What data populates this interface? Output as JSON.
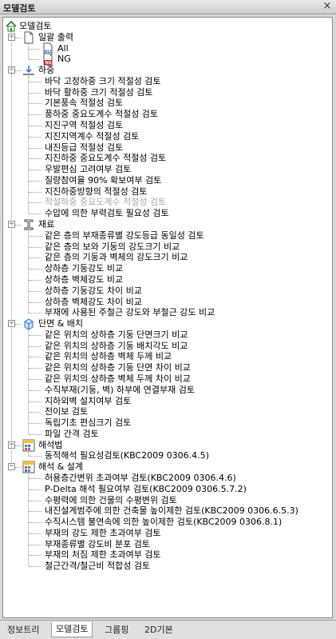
{
  "window": {
    "title": "모델검토"
  },
  "root": {
    "label": "모델검토"
  },
  "tree": [
    {
      "label": "일괄 출력",
      "icon": "document-icon",
      "children": [
        {
          "label": "All",
          "icon": "all-doc-icon"
        },
        {
          "label": "NG",
          "icon": "ng-doc-icon"
        }
      ]
    },
    {
      "label": "하중",
      "icon": "load-icon",
      "children": [
        {
          "label": "바닥 고정하중 크기 적절성 검토"
        },
        {
          "label": "바닥 활하중 크기 적절성 검토"
        },
        {
          "label": "기본풍속 적절성 검토"
        },
        {
          "label": "풍하중 중요도계수 적절성 검토"
        },
        {
          "label": "지진구역 적절성 검토"
        },
        {
          "label": "지진지역계수 적절성 검토"
        },
        {
          "label": "내진등급 적절성 검토"
        },
        {
          "label": "지진하중 중요도계수 적절성 검토"
        },
        {
          "label": "우발편심 고려여부 검토"
        },
        {
          "label": "질량참여율 90% 확보여부 검토"
        },
        {
          "label": "지진하중방향의 적절성 검토"
        },
        {
          "label": "적설하중 중요도계수 적절성 검토",
          "disabled": true
        },
        {
          "label": "수압에 의한 부력검토 필요성 검토"
        }
      ]
    },
    {
      "label": "재료",
      "icon": "material-icon",
      "children": [
        {
          "label": "같은 층의 부재종류별 강도등급 동일성 검토"
        },
        {
          "label": "같은 층의 보와 기둥의 강도크기 비교"
        },
        {
          "label": "같은 층의 기둥과 벽체의 강도크기 비교"
        },
        {
          "label": "상하층 기둥강도 비교"
        },
        {
          "label": "상하층 벽체강도 비교"
        },
        {
          "label": "상하층 기둥강도 차이 비교"
        },
        {
          "label": "상하층 벽체강도 차이 비교"
        },
        {
          "label": "부재에 사용된 주철근 강도와 부철근 강도 비교"
        }
      ]
    },
    {
      "label": "단면 & 배치",
      "icon": "section-icon",
      "children": [
        {
          "label": "같은 위치의 상하층 기둥 단면크기 비교"
        },
        {
          "label": "같은 위치의 상하층 기둥 배치각도 비교"
        },
        {
          "label": "같은 위치의 상하층 벽체 두께 비교"
        },
        {
          "label": "같은 위치의 상하층 기둥 단면 차이 비교"
        },
        {
          "label": "같은 위치의 상하층 벽체 두께 차이 비교"
        },
        {
          "label": "수직부재(기둥, 벽) 하부에 연결부재 검토"
        },
        {
          "label": "지하외벽 설치여부 검토"
        },
        {
          "label": "전이보 검토"
        },
        {
          "label": "독립기초 편심크기 검토"
        },
        {
          "label": "파일 간격 검토"
        }
      ]
    },
    {
      "label": "해석법",
      "icon": "analysis-icon",
      "children": [
        {
          "label": "동적해석 필요성검토(KBC2009 0306.4.5)"
        }
      ]
    },
    {
      "label": "해석 & 설계",
      "icon": "design-icon",
      "children": [
        {
          "label": "허용층간변위 초과여부 검토(KBC2009 0306.4.6)"
        },
        {
          "label": "P-Delta 해석 필요여부 검토(KBC2009 0306.5.7.2)"
        },
        {
          "label": "수평력에 의한 건물의 수평변위 검토"
        },
        {
          "label": "내진설계범주에 의한 건축물 높이제한 검토(KBC2009 0306.6.5.3)"
        },
        {
          "label": "수직시스템 불연속에 의한 높이제한 검토(KBC2009 0306.8.1)"
        },
        {
          "label": "부재의 강도 제한 초과여부 검토"
        },
        {
          "label": "부재종류별 강도비 분포 검토"
        },
        {
          "label": "부재의 처짐 제한 초과여부 검토"
        },
        {
          "label": "철근간격/철근비 적합성 검토"
        }
      ]
    }
  ],
  "tabs": [
    {
      "label": "정보트리",
      "active": false
    },
    {
      "label": "모델검토",
      "active": true
    },
    {
      "label": "그룹핑",
      "active": false
    },
    {
      "label": "2D기본",
      "active": false
    }
  ],
  "colors": {
    "ng_red": "#d21f1f",
    "icon_blue": "#2f6fd0",
    "disabled_text": "#a8a8a8"
  }
}
